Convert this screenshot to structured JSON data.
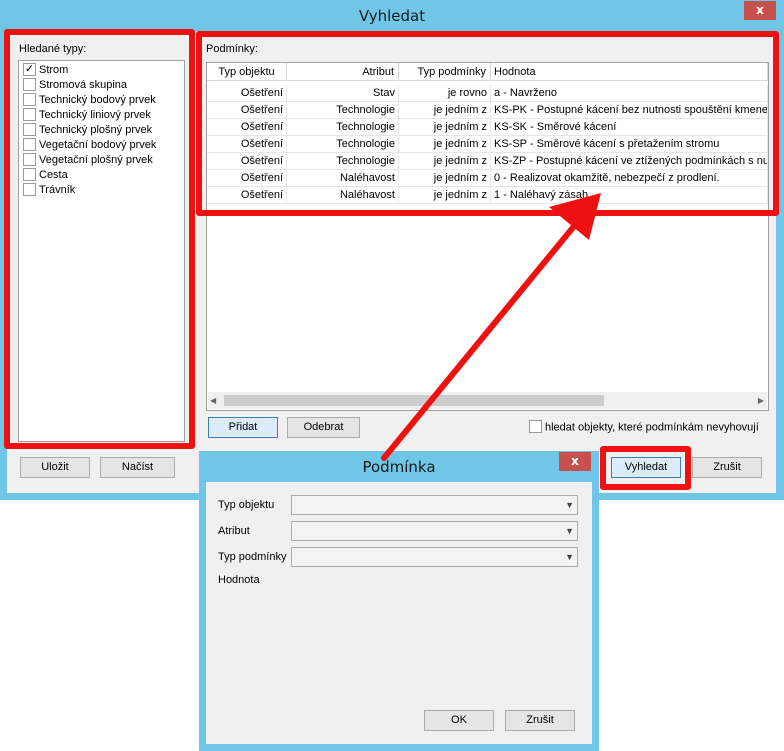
{
  "main_window": {
    "title": "Vyhledat",
    "close_glyph": "x",
    "types_label": "Hledané typy:",
    "types": [
      {
        "label": "Strom",
        "checked": true
      },
      {
        "label": "Stromová skupina",
        "checked": false
      },
      {
        "label": "Technický bodový prvek",
        "checked": false
      },
      {
        "label": "Technický liniový prvek",
        "checked": false
      },
      {
        "label": "Technický plošný prvek",
        "checked": false
      },
      {
        "label": "Vegetační bodový prvek",
        "checked": false
      },
      {
        "label": "Vegetační plošný prvek",
        "checked": false
      },
      {
        "label": "Cesta",
        "checked": false
      },
      {
        "label": "Trávník",
        "checked": false
      }
    ],
    "check_mark": "✓",
    "conditions_label": "Podmínky:",
    "columns": [
      "Typ objektu",
      "Atribut",
      "Typ podmínky",
      "Hodnota"
    ],
    "rows": [
      [
        "Ošetření",
        "Stav",
        "je rovno",
        "a - Navrženo"
      ],
      [
        "Ošetření",
        "Technologie",
        "je jedním z",
        "KS-PK - Postupné kácení bez nutnosti spouštění kmene a"
      ],
      [
        "Ošetření",
        "Technologie",
        "je jedním z",
        "KS-SK - Směrové kácení"
      ],
      [
        "Ošetření",
        "Technologie",
        "je jedním z",
        "KS-SP - Směrové kácení s přetažením stromu"
      ],
      [
        "Ošetření",
        "Technologie",
        "je jedním z",
        "KS-ZP - Postupné kácení ve ztížených podmínkách s nutn"
      ],
      [
        "Ošetření",
        "Naléhavost",
        "je jedním z",
        "0 - Realizovat okamžitě, nebezpečí z prodlení."
      ],
      [
        "Ošetření",
        "Naléhavost",
        "je jedním z",
        "1 - Naléhavý zásah"
      ]
    ],
    "add_button": "Přidat",
    "remove_button": "Odebrat",
    "negate_label": "hledat objekty, které podmínkám nevyhovují",
    "save_button": "Uložit",
    "load_button": "Načíst",
    "search_button": "Vyhledat",
    "cancel_button": "Zrušit",
    "scroll_left": "◀",
    "scroll_right": "▶"
  },
  "condition_dialog": {
    "title": "Podmínka",
    "close_glyph": "x",
    "object_type_label": "Typ objektu",
    "attribute_label": "Atribut",
    "condition_type_label": "Typ podmínky",
    "value_label": "Hodnota",
    "ok_button": "OK",
    "cancel_button": "Zrušit",
    "dropdown_glyph": "▼"
  },
  "colors": {
    "frame": "#6fc6e6",
    "highlight": "#ee1111",
    "close": "#c7504d"
  }
}
